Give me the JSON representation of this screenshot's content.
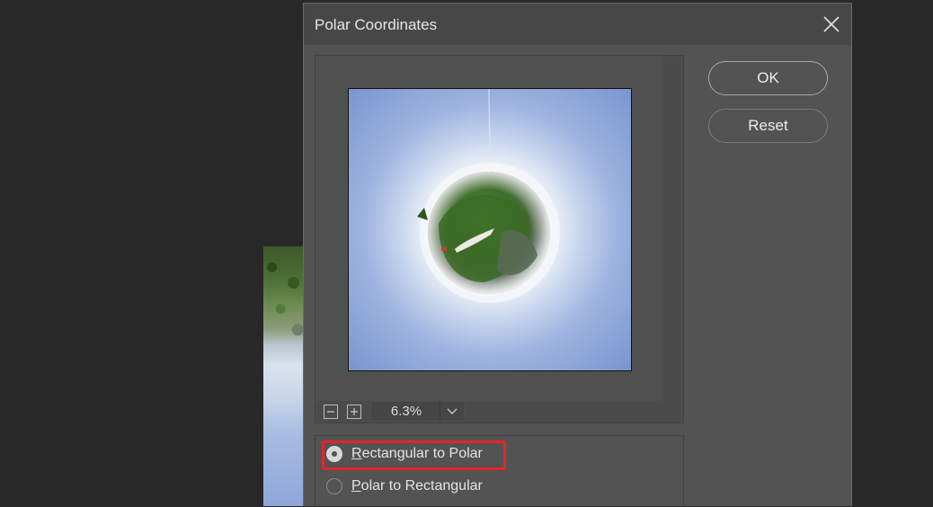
{
  "dialog": {
    "title": "Polar Coordinates",
    "close_icon": "close-icon"
  },
  "buttons": {
    "ok_label": "OK",
    "reset_label": "Reset"
  },
  "preview": {
    "zoom_out_icon": "minus-icon",
    "zoom_in_icon": "plus-icon",
    "zoom_value": "6.3%",
    "zoom_dropdown_icon": "chevron-down-icon"
  },
  "options": {
    "items": [
      {
        "prefix": "R",
        "rest": "ectangular to Polar",
        "checked": true
      },
      {
        "prefix": "P",
        "rest": "olar to Rectangular",
        "checked": false
      }
    ],
    "highlight_color": "#e8232a"
  },
  "colors": {
    "background": "#282828",
    "dialog": "#535353",
    "titlebar": "#474747",
    "sky": "#7f9bd3"
  }
}
